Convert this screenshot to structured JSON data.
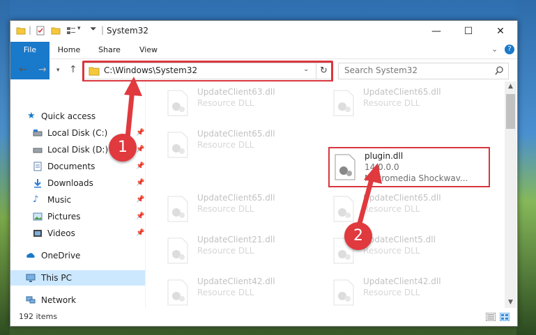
{
  "window": {
    "title": "System32"
  },
  "ribbon": {
    "tabs": [
      "File",
      "Home",
      "Share",
      "View"
    ]
  },
  "address": {
    "path": "C:\\Windows\\System32"
  },
  "search": {
    "placeholder": "Search System32"
  },
  "sidebar": {
    "items": [
      {
        "label": "Quick access",
        "icon": "star-icon"
      },
      {
        "label": "Local Disk (C:)",
        "icon": "drive-icon",
        "pinned": true
      },
      {
        "label": "Local Disk (D:)",
        "icon": "drive-icon",
        "pinned": true
      },
      {
        "label": "Documents",
        "icon": "documents-icon",
        "pinned": true
      },
      {
        "label": "Downloads",
        "icon": "downloads-icon",
        "pinned": true
      },
      {
        "label": "Music",
        "icon": "music-icon",
        "pinned": true
      },
      {
        "label": "Pictures",
        "icon": "pictures-icon",
        "pinned": true
      },
      {
        "label": "Videos",
        "icon": "videos-icon",
        "pinned": true
      },
      {
        "label": "OneDrive",
        "icon": "onedrive-icon"
      },
      {
        "label": "This PC",
        "icon": "this-pc-icon",
        "selected": true
      },
      {
        "label": "Network",
        "icon": "network-icon"
      }
    ]
  },
  "files": [
    {
      "name": "UpdateClient63.dll",
      "type": "Resource DLL"
    },
    {
      "name": "UpdateClient65.dll",
      "type": "Resource DLL"
    },
    {
      "name": "UpdateClient65.dll",
      "type": "Resource DLL"
    },
    {
      "name": "plugin.dll",
      "version": "14.0.0.0",
      "company": "Macromedia Shockwav..."
    },
    {
      "name": "UpdateClient65.dll",
      "type": "Resource DLL"
    },
    {
      "name": "UpdateClient65.dll",
      "type": "Resource DLL"
    },
    {
      "name": "UpdateClient21.dll",
      "type": "Resource DLL"
    },
    {
      "name": "UpdateClient5.dll",
      "type": "Resource DLL"
    },
    {
      "name": "UpdateClient42.dll",
      "type": "Resource DLL"
    },
    {
      "name": "UpdateClient42.dll",
      "type": "Resource DLL"
    }
  ],
  "status": {
    "items": "192 items"
  },
  "annotations": {
    "step1": "1",
    "step2": "2"
  },
  "colors": {
    "accent": "#1979ca",
    "highlight": "#d9363e",
    "selected": "#cce8ff"
  }
}
